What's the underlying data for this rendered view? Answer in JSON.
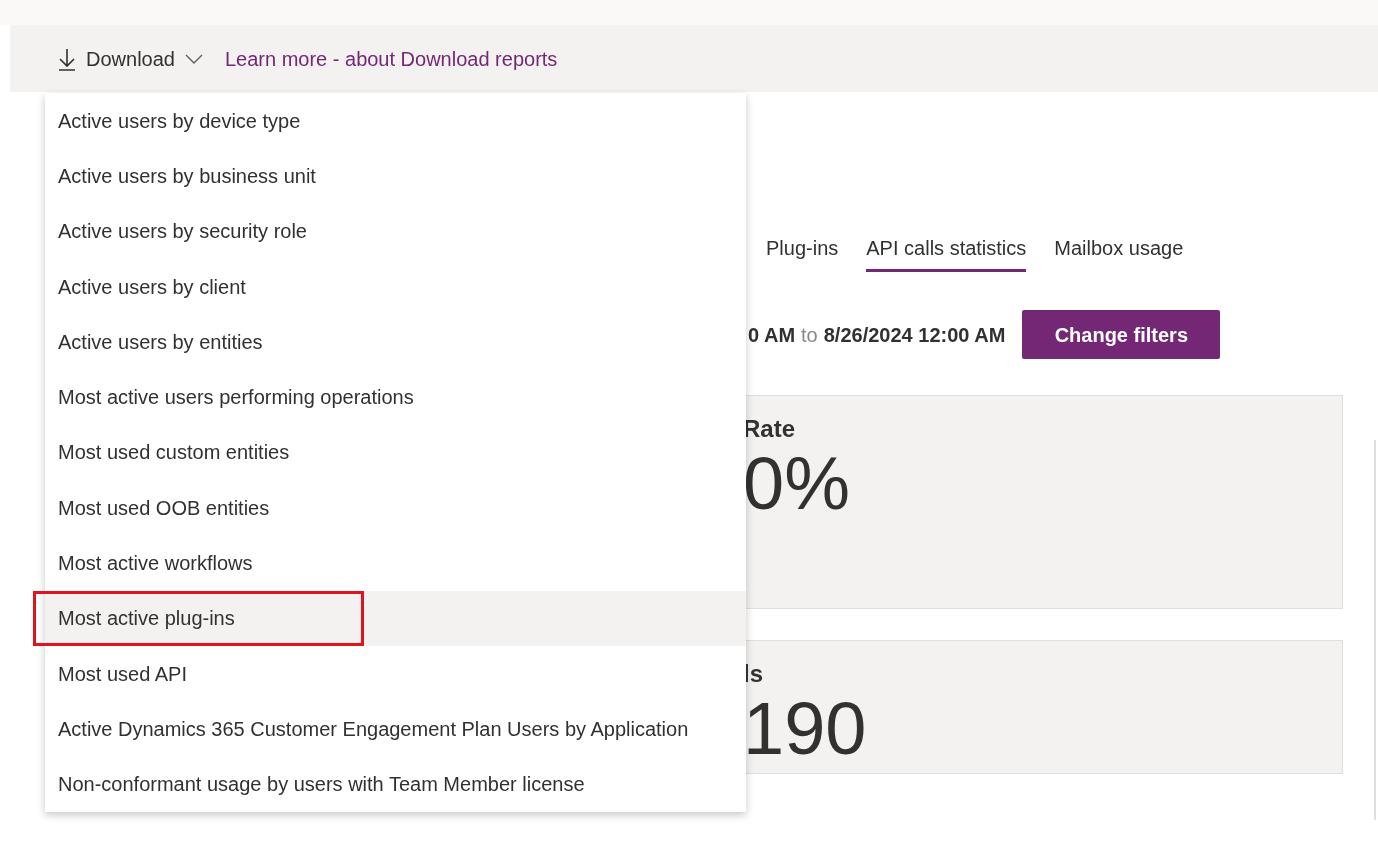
{
  "toolbar": {
    "download_button": "Download",
    "learn_more_link": "Learn more - about Download reports"
  },
  "download_menu": {
    "items": [
      {
        "label": "Active users by device type",
        "selected": false,
        "outlined": false
      },
      {
        "label": "Active users by business unit",
        "selected": false,
        "outlined": false
      },
      {
        "label": "Active users by security role",
        "selected": false,
        "outlined": false
      },
      {
        "label": "Active users by client",
        "selected": false,
        "outlined": false
      },
      {
        "label": "Active users by entities",
        "selected": false,
        "outlined": false
      },
      {
        "label": "Most active users performing operations",
        "selected": false,
        "outlined": false
      },
      {
        "label": "Most used custom entities",
        "selected": false,
        "outlined": false
      },
      {
        "label": "Most used OOB entities",
        "selected": false,
        "outlined": false
      },
      {
        "label": "Most active workflows",
        "selected": false,
        "outlined": false
      },
      {
        "label": "Most active plug-ins",
        "selected": true,
        "outlined": true
      },
      {
        "label": "Most used API",
        "selected": false,
        "outlined": false
      },
      {
        "label": "Active Dynamics 365 Customer Engagement Plan Users by Application",
        "selected": false,
        "outlined": false
      },
      {
        "label": "Non-conformant usage by users with Team Member license",
        "selected": false,
        "outlined": false
      }
    ]
  },
  "tabs": [
    {
      "label": "Plug-ins",
      "selected": false
    },
    {
      "label": "API calls statistics",
      "selected": true
    },
    {
      "label": "Mailbox usage",
      "selected": false
    }
  ],
  "filter": {
    "from_fragment": "0 AM",
    "connector": "to",
    "to_date": "8/26/2024 12:00 AM",
    "button": "Change filters"
  },
  "cards": [
    {
      "title_fragment": "Rate",
      "value_fragment": "0%"
    },
    {
      "title_fragment": "ls",
      "value_fragment": "190"
    }
  ]
}
